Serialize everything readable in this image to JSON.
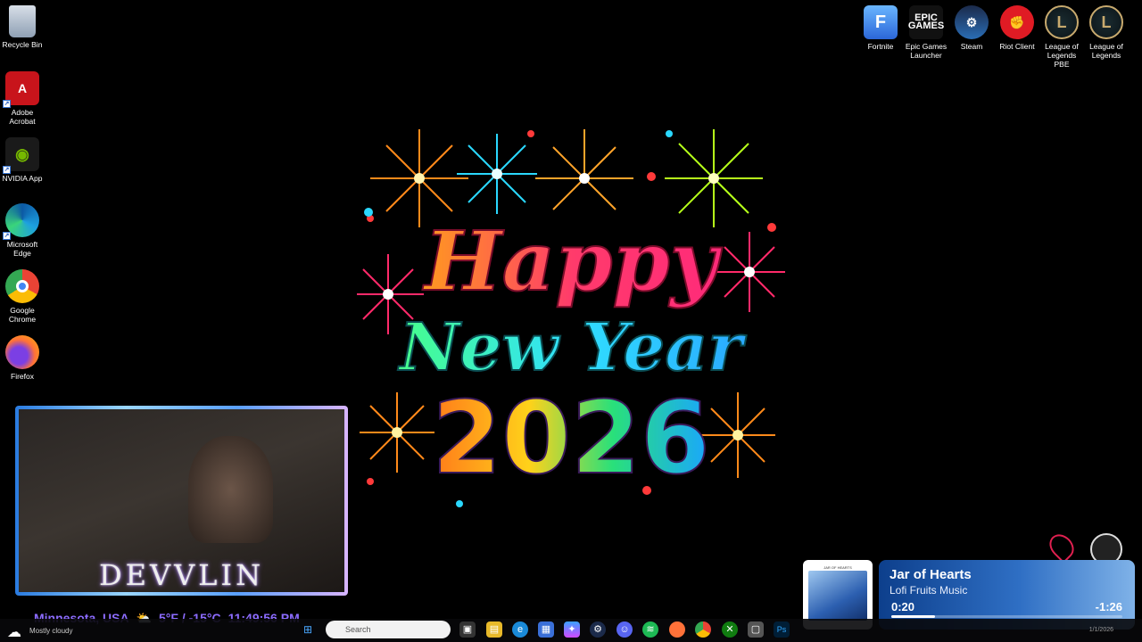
{
  "desktop_left": [
    {
      "label": "Recycle Bin",
      "icon": "recycle-bin-icon"
    },
    {
      "label": "Adobe Acrobat",
      "icon": "adobe-acrobat-icon"
    },
    {
      "label": "NVIDIA App",
      "icon": "nvidia-icon"
    },
    {
      "label": "Microsoft Edge",
      "icon": "edge-icon"
    },
    {
      "label": "Google Chrome",
      "icon": "chrome-icon"
    },
    {
      "label": "Firefox",
      "icon": "firefox-icon"
    }
  ],
  "desktop_right": [
    {
      "label": "Fortnite",
      "icon": "fortnite-icon"
    },
    {
      "label": "Epic Games Launcher",
      "icon": "epic-games-icon",
      "logo_text": "EPIC\nGAMES"
    },
    {
      "label": "Steam",
      "icon": "steam-icon"
    },
    {
      "label": "Riot Client",
      "icon": "riot-client-icon"
    },
    {
      "label": "League of Legends PBE",
      "icon": "league-pbe-icon"
    },
    {
      "label": "League of Legends",
      "icon": "league-icon"
    }
  ],
  "wallpaper": {
    "line1": "Happy",
    "line2": "New Year",
    "line3": "2026"
  },
  "webcam": {
    "brand": "DEVVLIN"
  },
  "overlay": {
    "location": "Minnesota, USA",
    "temp": "5°F / -15°C",
    "clock": "11:49:56 PM"
  },
  "now_playing": {
    "cover_label": "JAR OF HEARTS",
    "title": "Jar of Hearts",
    "artist": "Lofi Fruits Music",
    "elapsed": "0:20",
    "remaining": "-1:26",
    "progress": 0.19
  },
  "taskbar": {
    "weather": "Mostly cloudy",
    "search_placeholder": "Search",
    "date": "1/1/2026",
    "apps": [
      "task-view-icon",
      "edge-icon",
      "file-explorer-icon",
      "microsoft-store-icon",
      "copilot-icon",
      "steam-icon",
      "discord-icon",
      "spotify-icon",
      "firefox-icon",
      "chrome-icon",
      "xbox-icon",
      "media-icon",
      "photoshop-icon"
    ]
  },
  "colors": {
    "overlay_text": "#8c6cff",
    "np_card_start": "#0d3f8c",
    "np_card_end": "#7fb2e8"
  }
}
